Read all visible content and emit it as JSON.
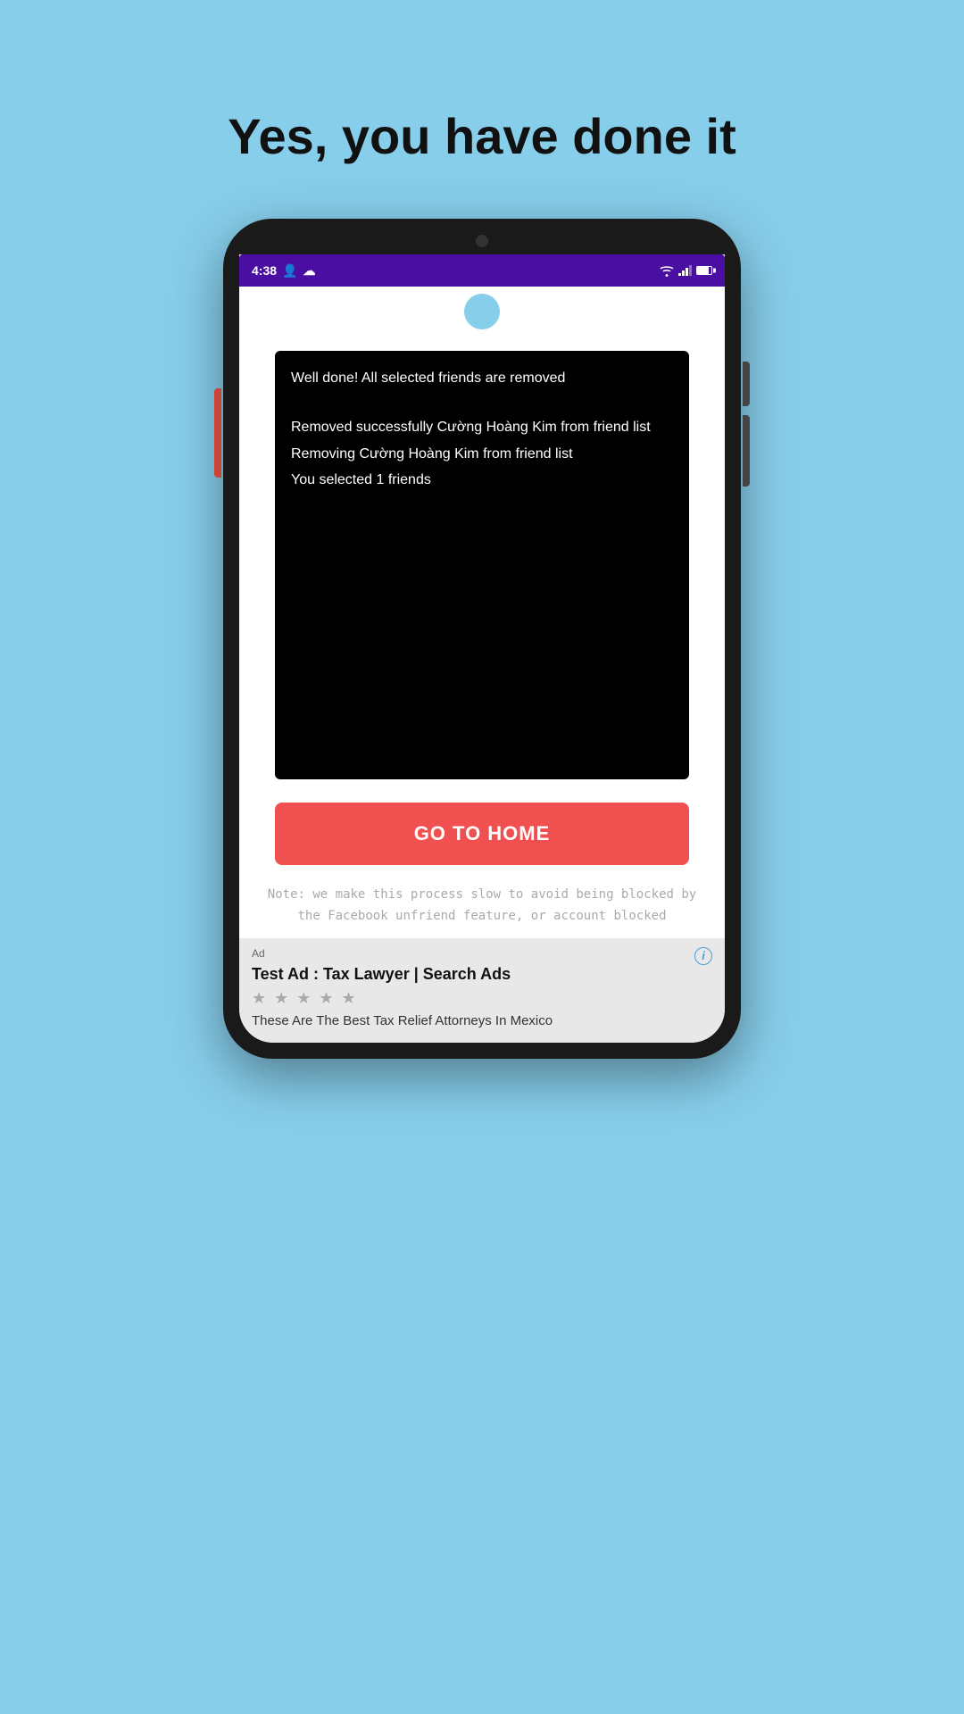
{
  "page": {
    "background_color": "#87CEEB",
    "title": "Yes, you have done it"
  },
  "status_bar": {
    "time": "4:38",
    "background_color": "#4a0ea3"
  },
  "console": {
    "line1": "Well done! All selected friends are removed",
    "line2": "Removed successfully Cường Hoàng Kim from friend list",
    "line3": "Removing Cường Hoàng Kim from friend list",
    "line4": "You selected 1 friends"
  },
  "go_home_button": {
    "label": "GO TO HOME",
    "background_color": "#f05050"
  },
  "note": {
    "text": "Note: we make this process slow to avoid being blocked by the Facebook unfriend feature, or account blocked"
  },
  "ad": {
    "label": "Ad",
    "title": "Test Ad : Tax Lawyer | Search Ads",
    "stars": "★ ★ ★ ★ ★",
    "description": "These Are The Best Tax Relief Attorneys In Mexico"
  }
}
